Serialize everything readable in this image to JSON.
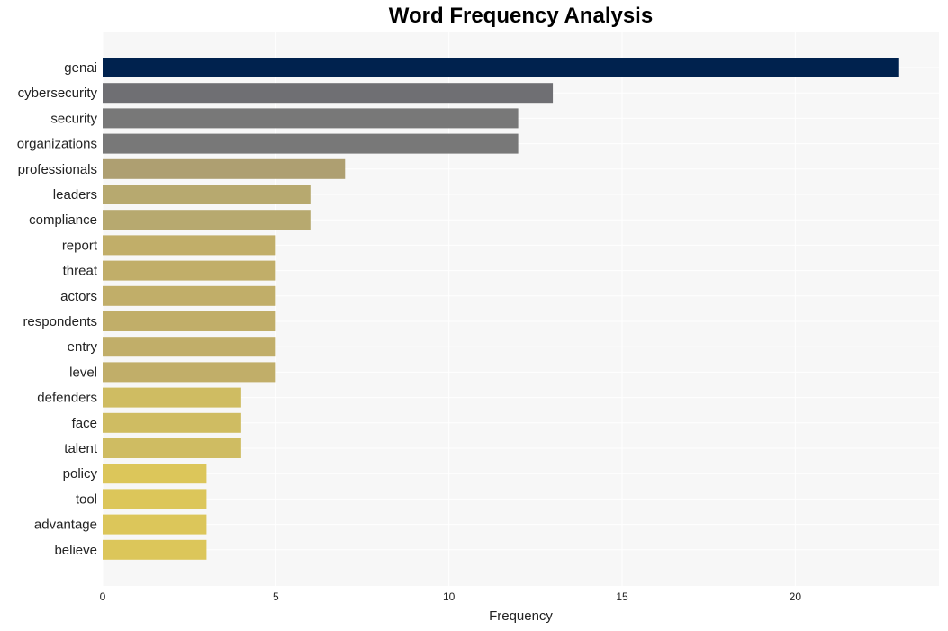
{
  "chart_data": {
    "type": "bar",
    "orientation": "horizontal",
    "title": "Word Frequency Analysis",
    "xlabel": "Frequency",
    "ylabel": "",
    "xlim": [
      0,
      24.15
    ],
    "xticks": [
      0,
      5,
      10,
      15,
      20
    ],
    "grid": true,
    "categories": [
      "genai",
      "cybersecurity",
      "security",
      "organizations",
      "professionals",
      "leaders",
      "compliance",
      "report",
      "threat",
      "actors",
      "respondents",
      "entry",
      "level",
      "defenders",
      "face",
      "talent",
      "policy",
      "tool",
      "advantage",
      "believe"
    ],
    "values": [
      23,
      13,
      12,
      12,
      7,
      6,
      6,
      5,
      5,
      5,
      5,
      5,
      5,
      4,
      4,
      4,
      3,
      3,
      3,
      3
    ],
    "colors": [
      "#00224e",
      "#6f6f73",
      "#787878",
      "#787878",
      "#ae9f71",
      "#b7a96f",
      "#b7a96f",
      "#c1ae69",
      "#c1ae69",
      "#c1ae69",
      "#c1ae69",
      "#c1ae69",
      "#c1ae69",
      "#cfbc62",
      "#cfbc62",
      "#cfbc62",
      "#dcc65a",
      "#dcc65a",
      "#dcc65a",
      "#dcc65a"
    ]
  },
  "style": {
    "plot_background": "#f7f7f7",
    "grid_color": "#ffffff"
  }
}
